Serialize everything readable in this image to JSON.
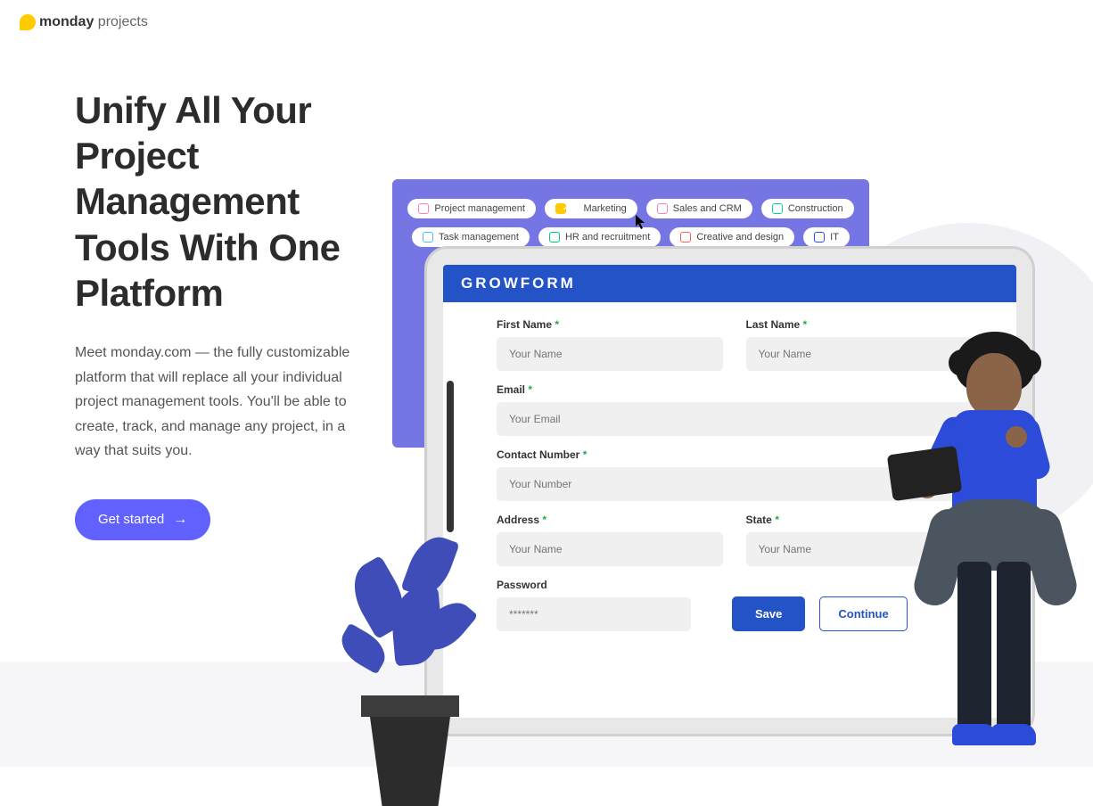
{
  "logo": {
    "brand": "monday",
    "product": "projects"
  },
  "hero": {
    "headline": "Unify All Your Project Management Tools With One Platform",
    "body": "Meet monday.com — the fully customizable platform that will replace all your individual project management tools. You'll be able to create, track, and manage any project, in a way that suits you.",
    "cta": "Get started"
  },
  "tags": {
    "row1": [
      "Project management",
      "Marketing",
      "Sales and CRM",
      "Construction"
    ],
    "row2": [
      "Task management",
      "HR and recruitment",
      "Creative and design",
      "IT"
    ]
  },
  "form": {
    "title": "GROWFORM",
    "first_name": {
      "label": "First Name",
      "placeholder": "Your Name"
    },
    "last_name": {
      "label": "Last Name",
      "placeholder": "Your Name"
    },
    "email": {
      "label": "Email",
      "placeholder": "Your Email"
    },
    "contact": {
      "label": "Contact Number",
      "placeholder": "Your Number"
    },
    "address": {
      "label": "Address",
      "placeholder": "Your Name"
    },
    "state": {
      "label": "State",
      "placeholder": "Your Name"
    },
    "password": {
      "label": "Password",
      "placeholder": "*******"
    },
    "save": "Save",
    "continue": "Continue"
  }
}
